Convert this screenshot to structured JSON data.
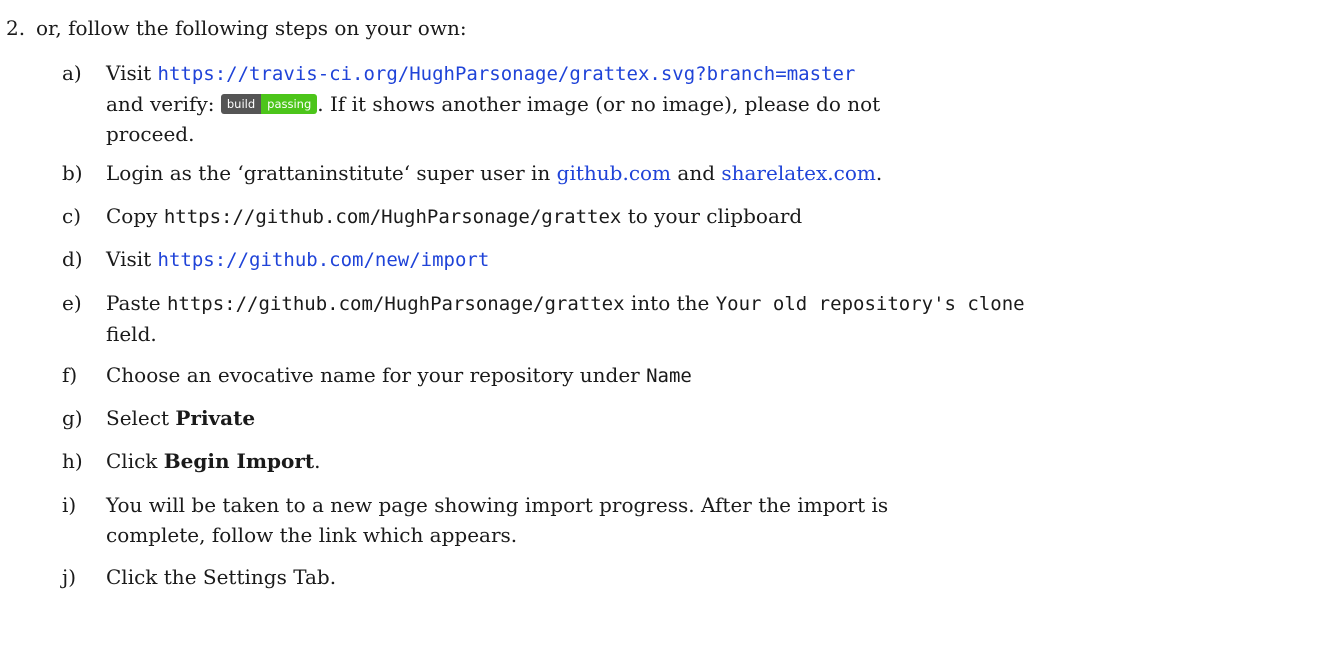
{
  "item": {
    "number": "2.",
    "text": "or, follow the following steps on your own:"
  },
  "steps": {
    "a": {
      "label": "a)",
      "visit": "Visit",
      "url": "https://travis-ci.org/HughParsonage/grattex.svg?branch=master",
      "verify_prefix": "and verify:",
      "badge_left": "build",
      "badge_right": "passing",
      "verify_suffix": ". If it shows another image (or no image), please do not",
      "line3": "proceed."
    },
    "b": {
      "label": "b)",
      "prefix": "Login as the ‘grattaninstitute‘ super user in",
      "link1": "github.com",
      "mid": "and",
      "link2": "sharelatex.com",
      "suffix": "."
    },
    "c": {
      "label": "c)",
      "prefix": "Copy",
      "code": "https://github.com/HughParsonage/grattex",
      "suffix": "to your clipboard"
    },
    "d": {
      "label": "d)",
      "prefix": "Visit",
      "url": "https://github.com/new/import"
    },
    "e": {
      "label": "e)",
      "prefix": "Paste",
      "code": "https://github.com/HughParsonage/grattex",
      "mid": "into the",
      "code2": "Your old repository's clone",
      "line2": "field."
    },
    "f": {
      "label": "f)",
      "prefix": "Choose an evocative name for your repository under",
      "code": "Name"
    },
    "g": {
      "label": "g)",
      "prefix": "Select",
      "bold": "Private"
    },
    "h": {
      "label": "h)",
      "prefix": "Click",
      "bold": "Begin Import",
      "suffix": "."
    },
    "i": {
      "label": "i)",
      "line1": "You will be taken to a new page showing import progress. After the import is",
      "line2": "complete, follow the link which appears."
    },
    "j": {
      "label": "j)",
      "text": "Click the Settings Tab."
    }
  },
  "colors": {
    "link": "#1f43d8",
    "badge_dark": "#555555",
    "badge_green": "#4cc51a"
  }
}
